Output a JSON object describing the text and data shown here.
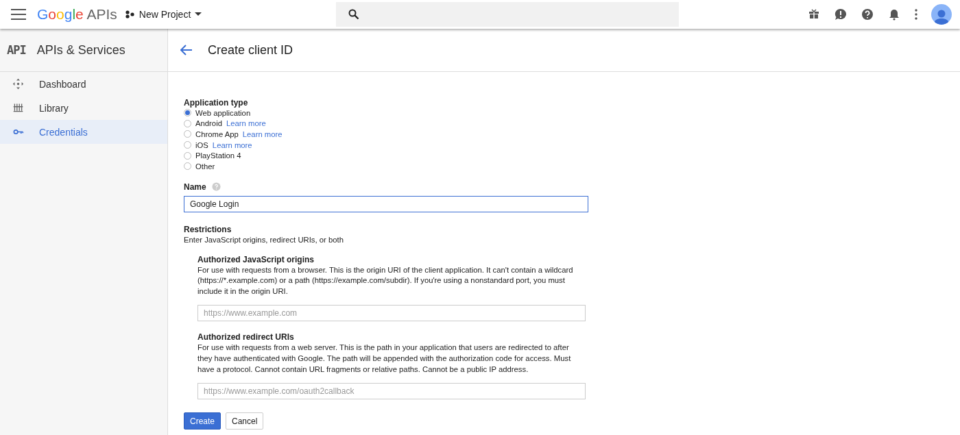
{
  "topbar": {
    "logo_brand": "Google",
    "logo_product": "APIs",
    "project": "New Project"
  },
  "sidebar": {
    "title": "APIs & Services",
    "logo": "API",
    "items": [
      {
        "label": "Dashboard",
        "selected": false
      },
      {
        "label": "Library",
        "selected": false
      },
      {
        "label": "Credentials",
        "selected": true
      }
    ]
  },
  "page": {
    "title": "Create client ID"
  },
  "form": {
    "application_type": {
      "label": "Application type",
      "options": [
        {
          "label": "Web application",
          "selected": true
        },
        {
          "label": "Android",
          "link": "Learn more",
          "selected": false
        },
        {
          "label": "Chrome App",
          "link": "Learn more",
          "selected": false
        },
        {
          "label": "iOS",
          "link": "Learn more",
          "selected": false
        },
        {
          "label": "PlayStation 4",
          "selected": false
        },
        {
          "label": "Other",
          "selected": false
        }
      ]
    },
    "name": {
      "label": "Name",
      "value": "Google Login"
    },
    "restrictions": {
      "title": "Restrictions",
      "subtitle": "Enter JavaScript origins, redirect URIs, or both",
      "sections": [
        {
          "title": "Authorized JavaScript origins",
          "description": "For use with requests from a browser. This is the origin URI of the client application. It can't contain a wildcard (https://*.example.com) or a path (https://example.com/subdir). If you're using a nonstandard port, you must include it in the origin URI.",
          "placeholder": "https://www.example.com"
        },
        {
          "title": "Authorized redirect URIs",
          "description": "For use with requests from a web server. This is the path in your application that users are redirected to after they have authenticated with Google. The path will be appended with the authorization code for access. Must have a protocol. Cannot contain URL fragments or relative paths. Cannot be a public IP address.",
          "placeholder": "https://www.example.com/oauth2callback"
        }
      ]
    },
    "buttons": [
      {
        "label": "Create",
        "kind": "primary"
      },
      {
        "label": "Cancel",
        "kind": "secondary"
      }
    ]
  }
}
